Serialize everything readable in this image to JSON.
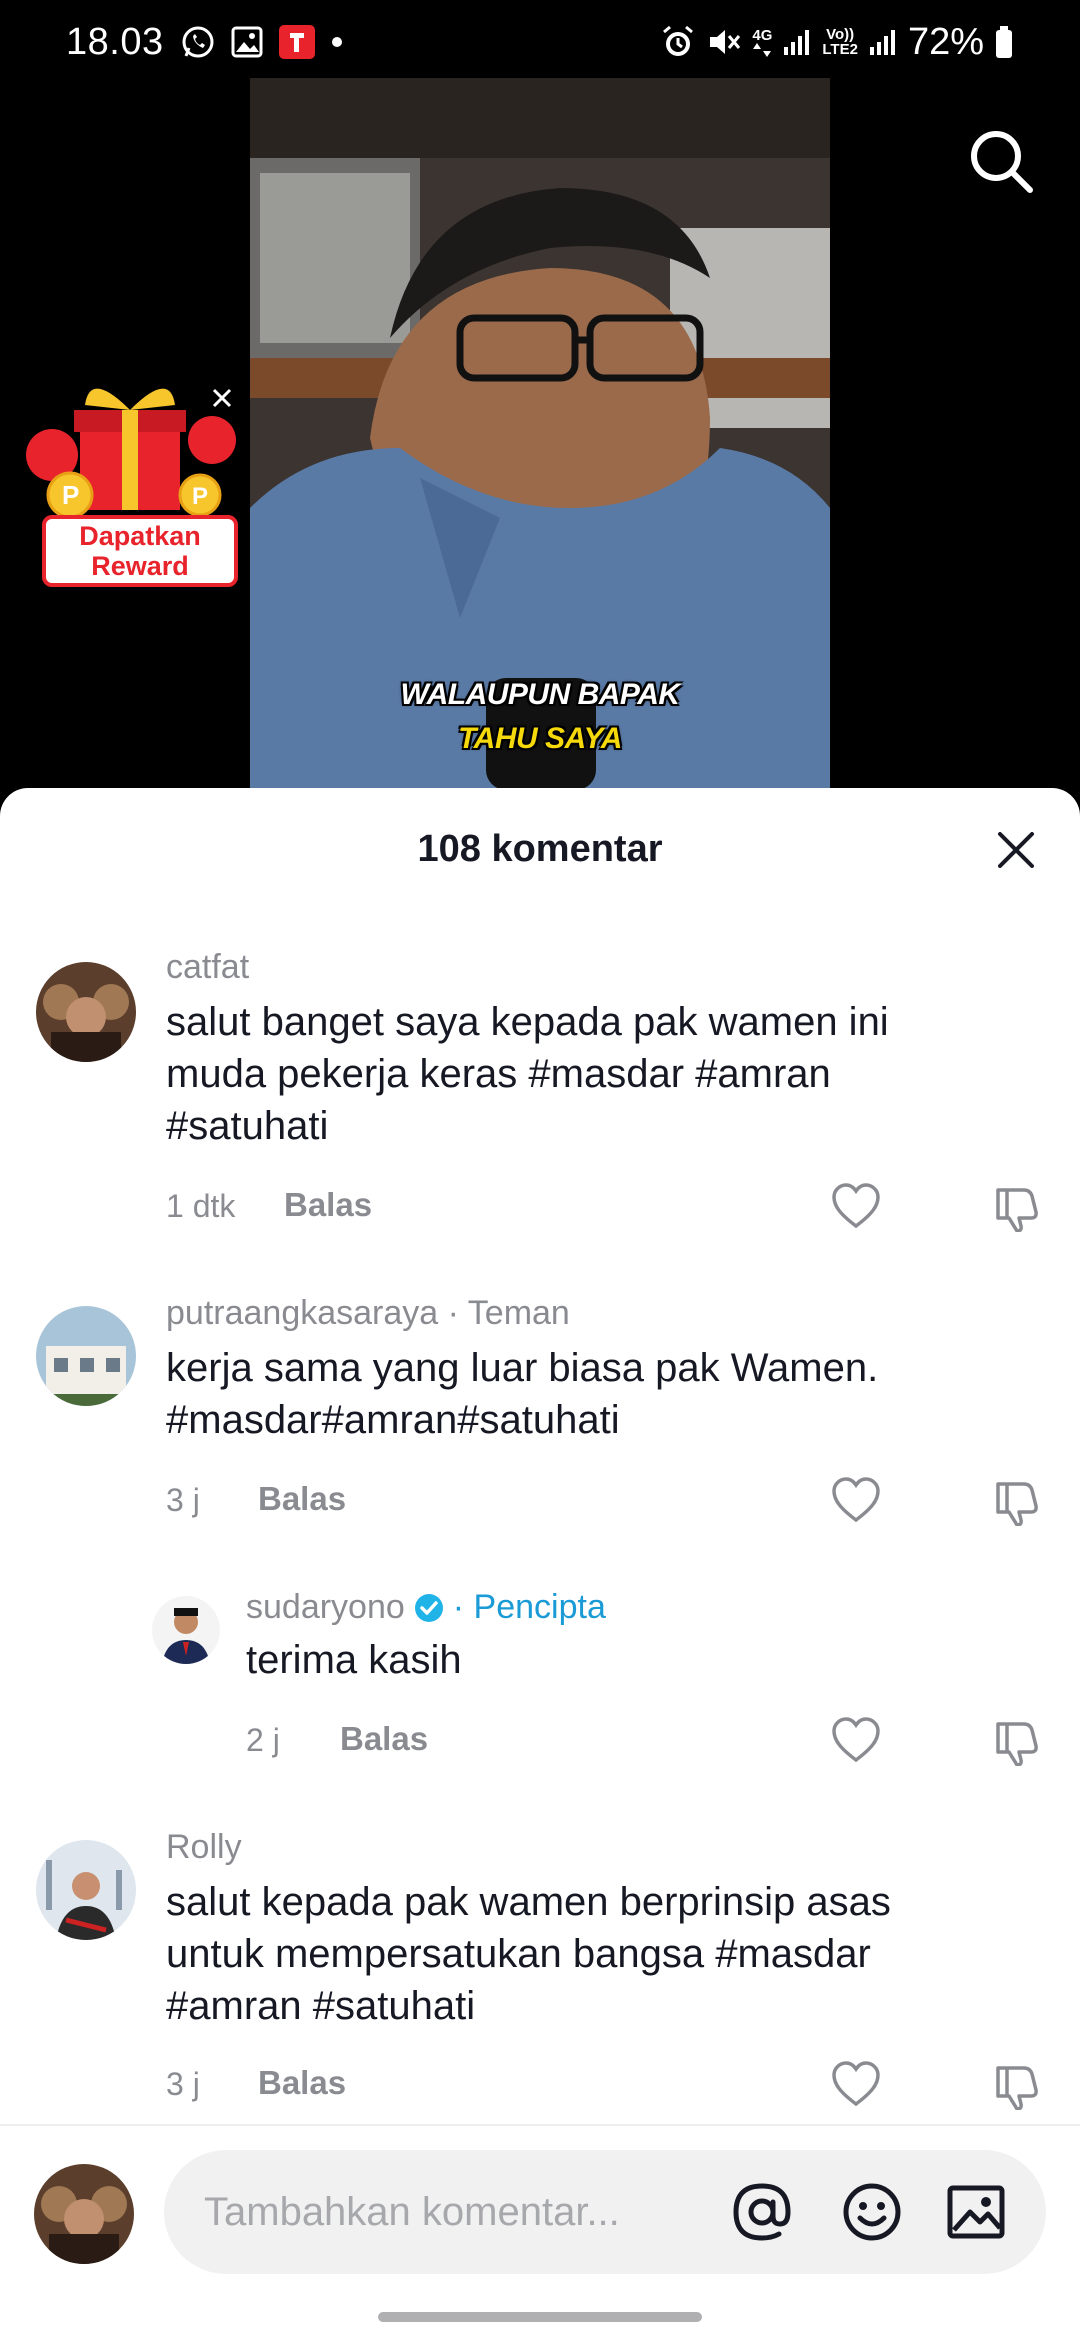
{
  "status_bar": {
    "time": "18.03",
    "net_4g": "4G",
    "volte": "Vo))",
    "lte2": "LTE2",
    "battery": "72%"
  },
  "video": {
    "caption_line1": "WALAUPUN BAPAK",
    "caption_line2": "TAHU SAYA"
  },
  "reward": {
    "line1": "Dapatkan",
    "line2": "Reward"
  },
  "comments_sheet": {
    "title": "108 komentar",
    "comments": [
      {
        "username": "catfat",
        "tag": "",
        "text_lines": [
          "salut banget saya kepada pak wamen ini",
          "muda pekerja keras #masdar #amran",
          "#satuhati"
        ],
        "time": "1 dtk",
        "reply_label": "Balas"
      },
      {
        "username": "putraangkasaraya",
        "tag": "· Teman",
        "text_lines": [
          "kerja sama yang luar biasa pak Wamen.",
          "#masdar#amran#satuhati"
        ],
        "time": "3 j",
        "reply_label": "Balas"
      },
      {
        "username": "sudaryono",
        "tag": "· Pencipta",
        "text_lines": [
          "terima kasih"
        ],
        "time": "2 j",
        "reply_label": "Balas"
      },
      {
        "username": "Rolly",
        "tag": "",
        "text_lines": [
          "salut kepada pak wamen berprinsip asas",
          "untuk mempersatukan bangsa #masdar",
          "#amran #satuhati"
        ],
        "time": "3 j",
        "reply_label": "Balas"
      }
    ]
  },
  "input_bar": {
    "placeholder": "Tambahkan komentar..."
  },
  "colors": {
    "creator_accent": "#1a9bd6",
    "reward_red": "#e8232b",
    "caption_yellow": "#f5d90a",
    "muted_text": "#8a8b91",
    "primary_text": "#161823"
  },
  "icons": [
    "whatsapp-icon",
    "gallery-icon",
    "tiktok-app-icon",
    "alarm-icon",
    "mute-icon",
    "signal-icon",
    "battery-icon",
    "search-icon",
    "gift-icon",
    "close-icon",
    "heart-icon",
    "dislike-icon",
    "verified-badge-icon",
    "mention-icon",
    "emoji-icon",
    "image-icon"
  ]
}
